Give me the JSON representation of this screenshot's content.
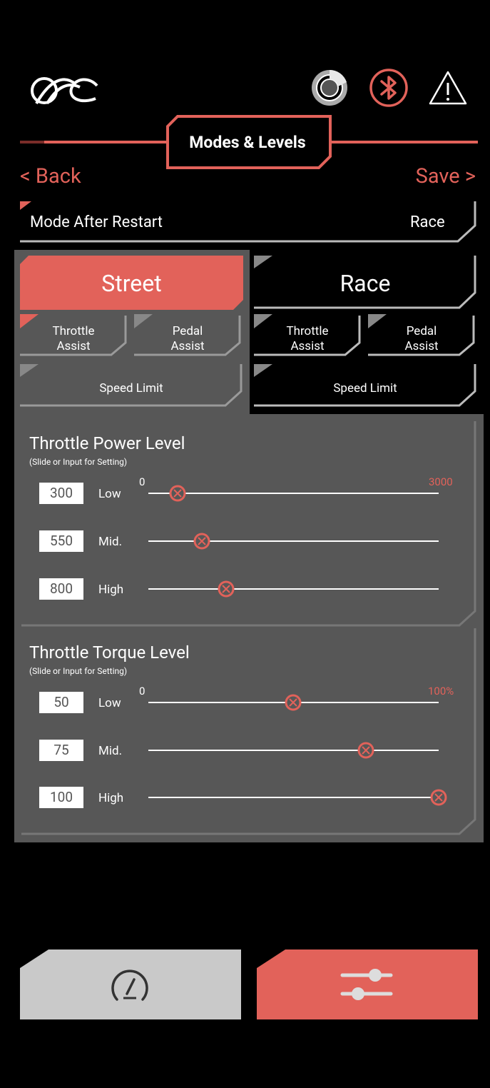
{
  "header": {
    "logo_icon": "brand-logo-icon",
    "icons": [
      "brake-disc-icon",
      "bluetooth-icon",
      "warning-icon"
    ]
  },
  "title": "Modes & Levels",
  "nav": {
    "back_label": "< Back",
    "save_label": "Save >"
  },
  "mode_after_restart": {
    "label": "Mode After Restart",
    "value": "Race"
  },
  "modes": {
    "street": {
      "label": "Street",
      "throttle_assist": "Throttle\nAssist",
      "pedal_assist": "Pedal\nAssist",
      "speed_limit": "Speed Limit"
    },
    "race": {
      "label": "Race",
      "throttle_assist": "Throttle\nAssist",
      "pedal_assist": "Pedal\nAssist",
      "speed_limit": "Speed Limit"
    }
  },
  "throttle_power": {
    "title": "Throttle Power Level",
    "subtitle": "(Slide or Input for Setting)",
    "min": "0",
    "max": "3000",
    "rows": [
      {
        "label": "Low",
        "value": "300"
      },
      {
        "label": "Mid.",
        "value": "550"
      },
      {
        "label": "High",
        "value": "800"
      }
    ]
  },
  "throttle_torque": {
    "title": "Throttle Torque Level",
    "subtitle": "(Slide or Input for Setting)",
    "min": "0",
    "max": "100%",
    "rows": [
      {
        "label": "Low",
        "value": "50"
      },
      {
        "label": "Mid.",
        "value": "75"
      },
      {
        "label": "High",
        "value": "100"
      }
    ]
  },
  "bottom_nav": {
    "items": [
      "gauge-icon",
      "sliders-icon"
    ]
  },
  "colors": {
    "accent": "#e2625a",
    "panel": "#575757",
    "inactive": "#c9c9c9"
  }
}
